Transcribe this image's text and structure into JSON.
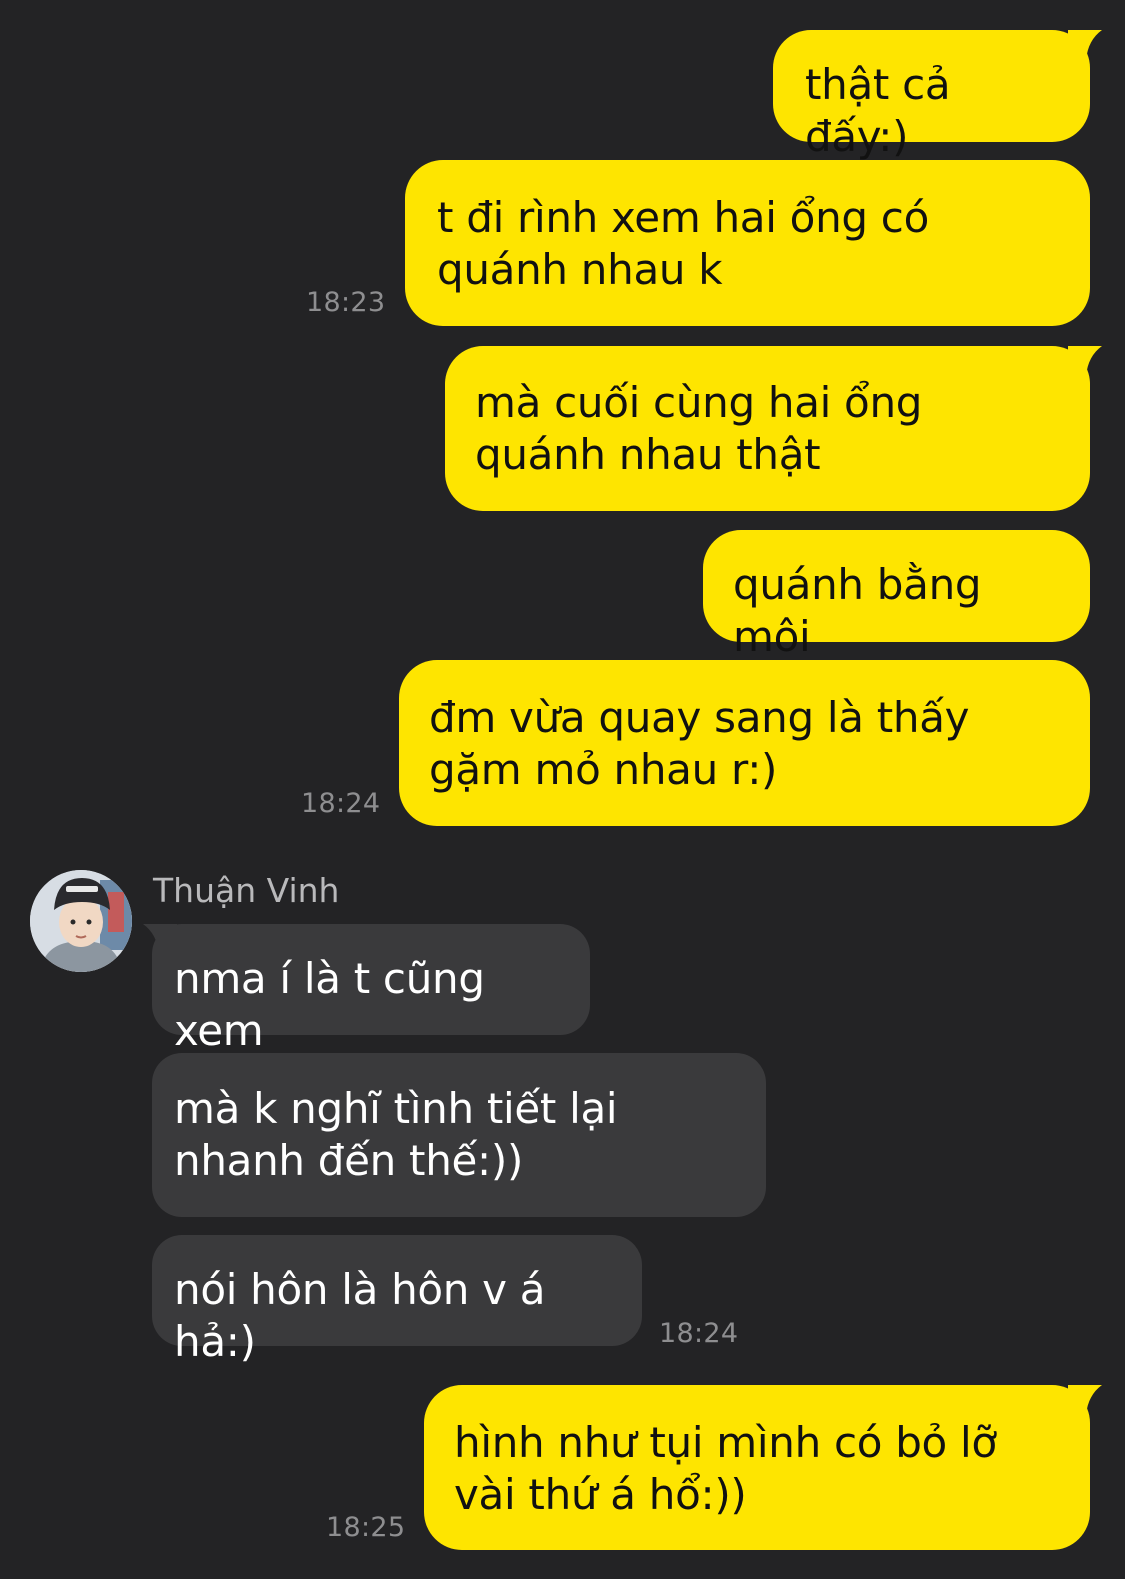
{
  "messages": [
    {
      "side": "out",
      "text": "thật cả đấy:)"
    },
    {
      "side": "out",
      "text": "t đi rình xem hai ổng có quánh nhau k",
      "time": "18:23"
    },
    {
      "side": "out",
      "text": "mà cuối cùng hai ổng quánh nhau thật"
    },
    {
      "side": "out",
      "text": "quánh bằng môi"
    },
    {
      "side": "out",
      "text": "đm vừa quay sang là thấy gặm mỏ nhau r:)",
      "time": "18:24"
    },
    {
      "side": "in",
      "sender": "Thuận Vinh",
      "text": "nma í là t cũng xem"
    },
    {
      "side": "in",
      "text": "mà k nghĩ tình tiết lại nhanh đến thế:))"
    },
    {
      "side": "in",
      "text": "nói hôn là hôn v á hả:)",
      "time": "18:24"
    },
    {
      "side": "out",
      "text": "hình như tụi mình có bỏ lỡ vài thứ á hổ:))",
      "time": "18:25"
    }
  ],
  "colors": {
    "background": "#232325",
    "outgoing_bubble": "#FEE500",
    "incoming_bubble": "#3A3A3C",
    "timestamp": "#8E8E90"
  }
}
